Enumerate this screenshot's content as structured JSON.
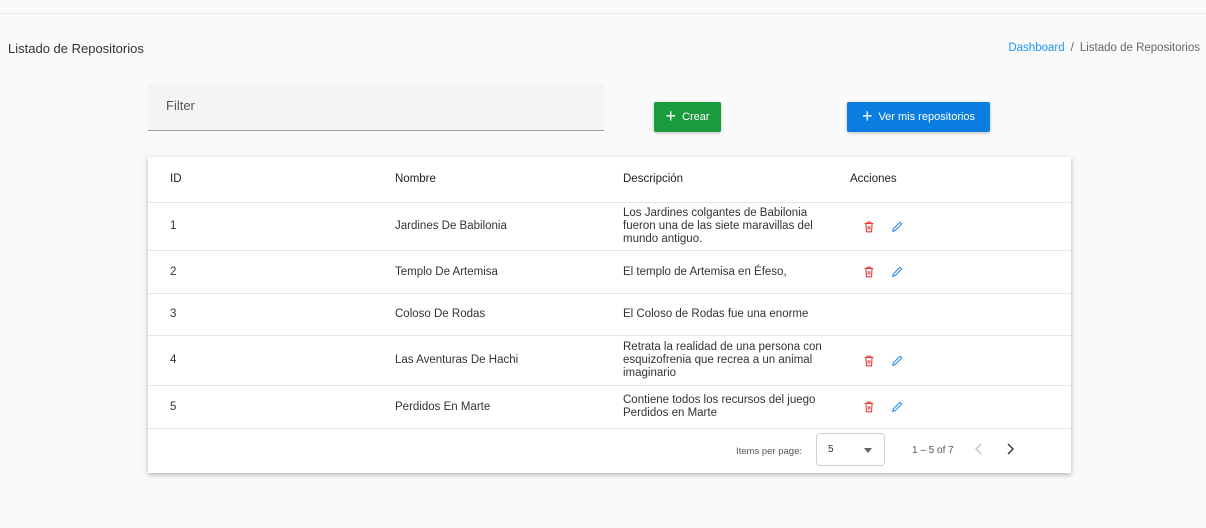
{
  "header": {
    "title": "Listado de Repositorios",
    "breadcrumb": {
      "link": "Dashboard",
      "separator": "/",
      "current": "Listado de Repositorios"
    }
  },
  "filter": {
    "placeholder": "Filter",
    "value": ""
  },
  "buttons": {
    "create": "Crear",
    "my_repos": "Ver mis repositorios"
  },
  "table": {
    "columns": [
      "ID",
      "Nombre",
      "Descripción",
      "Acciones"
    ],
    "rows": [
      {
        "id": "1",
        "nombre": "Jardines De Babilonia",
        "descripcion": "Los Jardines colgantes de Babilonia fueron una de las siete maravillas del mundo antiguo.",
        "actions": true
      },
      {
        "id": "2",
        "nombre": "Templo De Artemisa",
        "descripcion": "El templo de Artemisa en Éfeso,",
        "actions": true
      },
      {
        "id": "3",
        "nombre": "Coloso De Rodas",
        "descripcion": "El Coloso de Rodas fue una enorme",
        "actions": false
      },
      {
        "id": "4",
        "nombre": "Las Aventuras De Hachi",
        "descripcion": "Retrata la realidad de una persona con esquizofrenia que recrea a un animal imaginario",
        "actions": true
      },
      {
        "id": "5",
        "nombre": "Perdidos En Marte",
        "descripcion": "Contiene todos los recursos del juego Perdidos en Marte",
        "actions": true
      }
    ]
  },
  "paginator": {
    "items_per_page_label": "Items per page:",
    "items_per_page": "5",
    "range": "1 – 5 of 7"
  },
  "icons": {
    "delete": "trash-icon",
    "edit": "pencil-icon",
    "prev": "chevron-left-icon",
    "next": "chevron-right-icon"
  },
  "colors": {
    "primary": "#0b7de0",
    "success": "#1a9c3e",
    "danger": "#e53935",
    "link": "#2196f3"
  }
}
